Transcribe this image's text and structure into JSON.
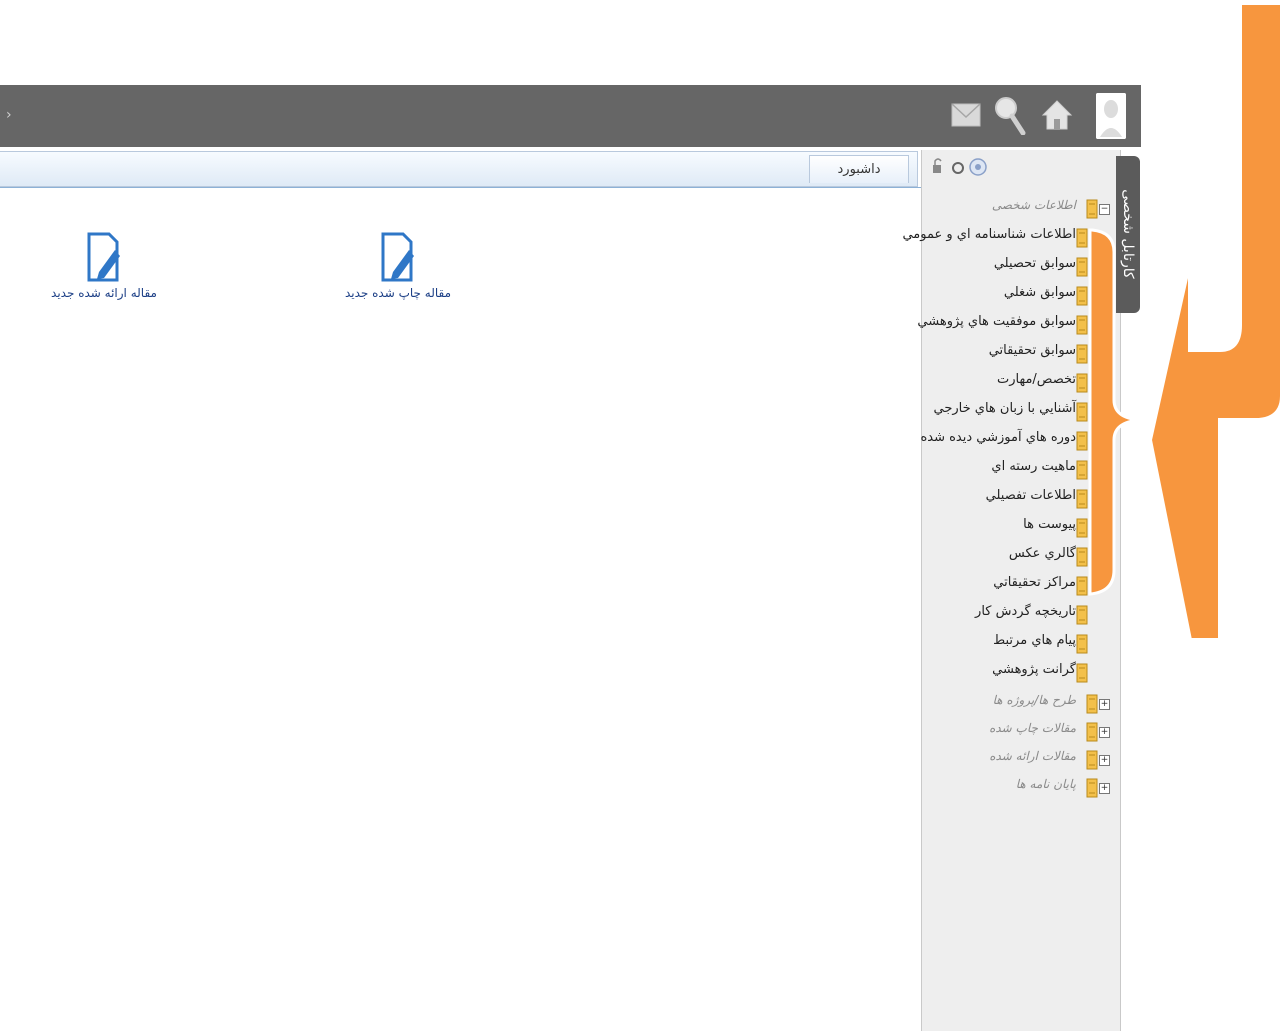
{
  "header": {
    "icons": [
      "mail-icon",
      "search-icon",
      "home-icon",
      "user-avatar-icon"
    ]
  },
  "tabs": {
    "dashboard_label": "داشبورد"
  },
  "shortcuts": {
    "published_article": "مقاله چاپ شده جدید",
    "presented_article": "مقاله ارائه شده جدید"
  },
  "sidebar": {
    "tab_label": "کارتابل شخصی",
    "root_label": "اطلاعات شخصی",
    "items": [
      "اطلاعات شناسنامه اي و عمومي",
      "سوابق تحصيلي",
      "سوابق شغلي",
      "سوابق موفقيت هاي پژوهشي",
      "سوابق تحقيقاتي",
      "تخصص/مهارت",
      "آشنايي با زبان هاي خارجي",
      "دوره هاي آموزشي ديده شده",
      "ماهيت رسته اي",
      "اطلاعات تفصيلي",
      "پيوست ها",
      "گالري عکس",
      "مراكز تحقيقاتي",
      "تاريخچه گردش كار",
      "پيام هاي مرتبط",
      "گرانت پژوهشي"
    ],
    "groups": [
      "طرح ها/پروژه ها",
      "مقالات چاپ شده",
      "مقالات ارائه شده",
      "پايان نامه ها"
    ]
  },
  "colors": {
    "topbar": "#666666",
    "accent_orange": "#f7963e",
    "link_blue": "#1c3f86"
  }
}
